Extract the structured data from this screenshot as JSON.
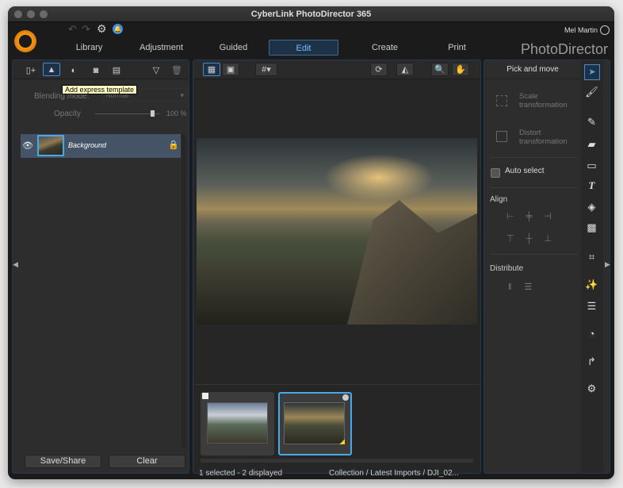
{
  "window": {
    "title": "CyberLink PhotoDirector 365"
  },
  "header": {
    "user": "Mel Martin",
    "brand": "PhotoDirector",
    "tabs": [
      {
        "label": "Library"
      },
      {
        "label": "Adjustment"
      },
      {
        "label": "Guided"
      },
      {
        "label": "Edit",
        "active": true
      },
      {
        "label": "Create"
      },
      {
        "label": "Print"
      }
    ]
  },
  "layers": {
    "tooltip": "Add express template",
    "blending_label": "Blending mode:",
    "blending_value": "Normal",
    "opacity_label": "Opacity",
    "opacity_value": "100 %",
    "opacity_percent": 100,
    "items": [
      {
        "name": "Background",
        "visible": true,
        "locked": true
      }
    ],
    "save_share": "Save/Share",
    "clear": "Clear"
  },
  "filmstrip": {
    "status": "1 selected - 2 displayed",
    "path": "Collection / Latest Imports / DJI_02...",
    "selected_index": 1
  },
  "tools": {
    "title": "Pick and move",
    "scale": [
      "Scale",
      "transformation"
    ],
    "distort": [
      "Distort",
      "transformation"
    ],
    "auto_select": "Auto select",
    "auto_select_checked": false,
    "align": "Align",
    "distribute": "Distribute"
  },
  "colors": {
    "accent": "#4aa8e8",
    "bg": "#2d2d2d",
    "active_tab": "#7fb8ff"
  }
}
